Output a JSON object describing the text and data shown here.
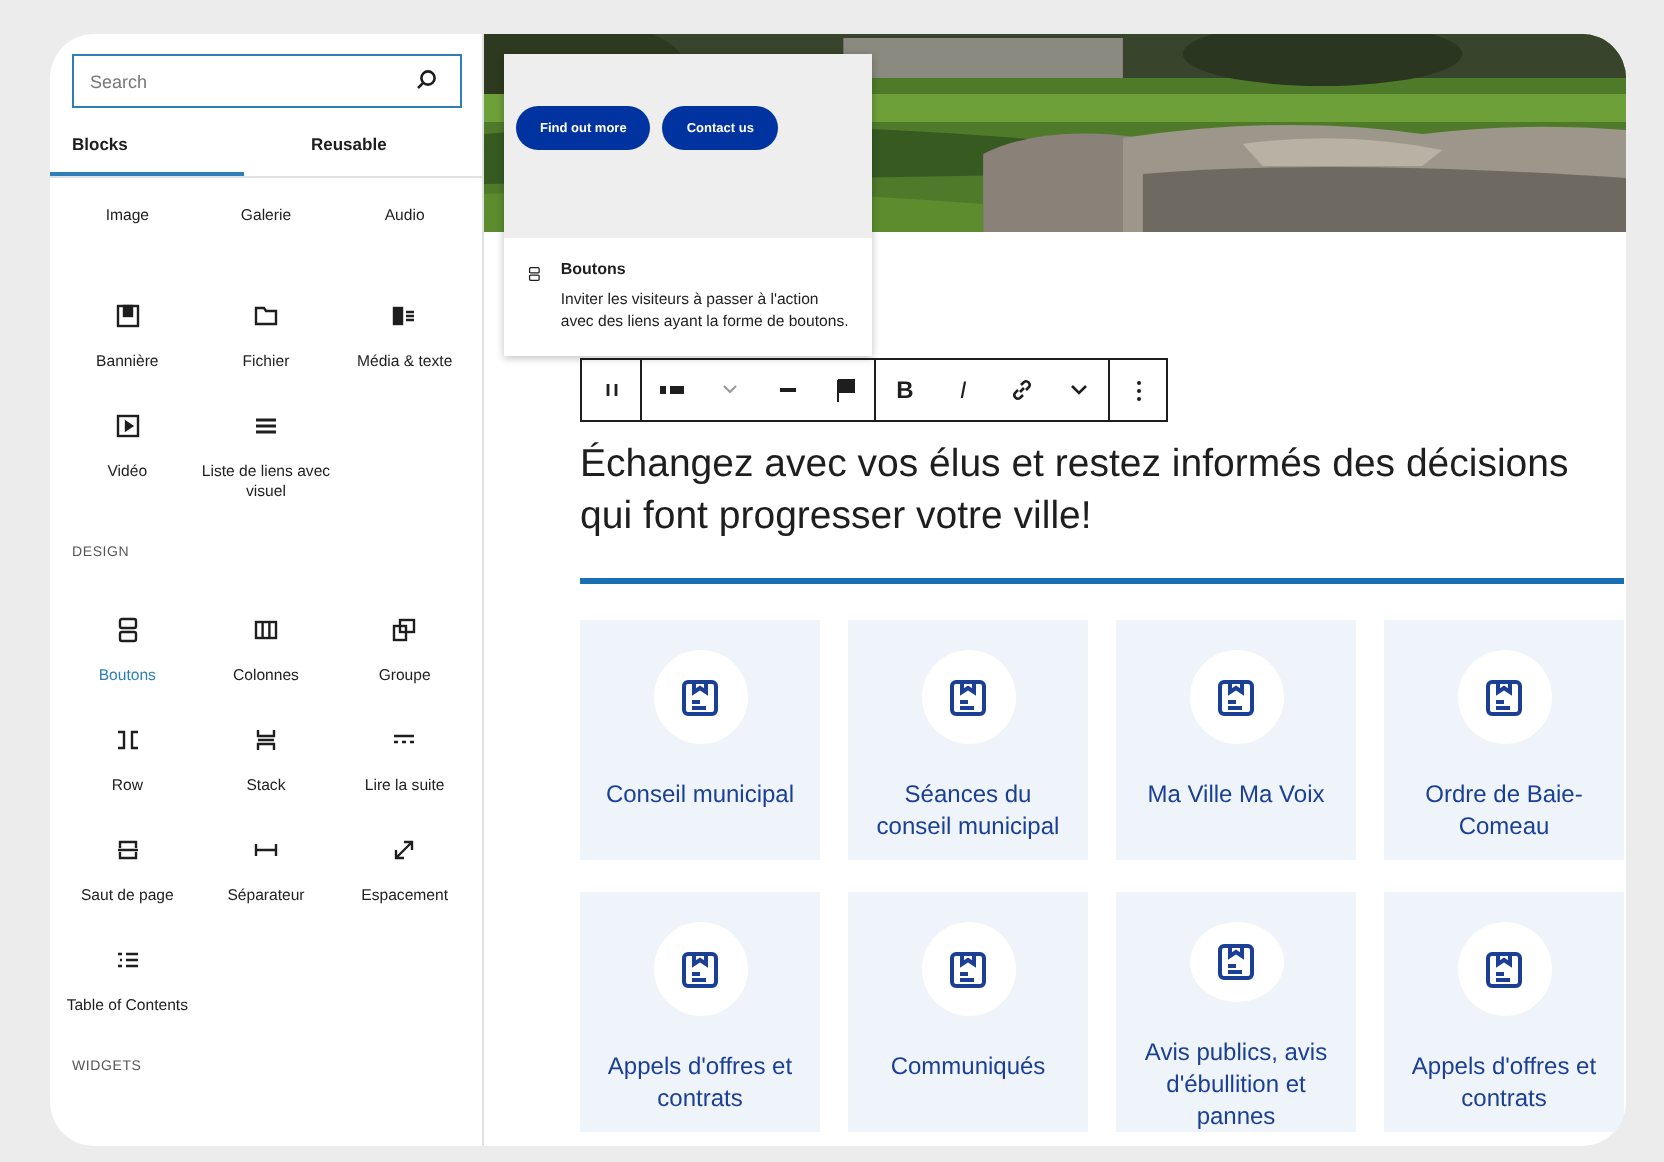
{
  "sidebar": {
    "search": {
      "placeholder": "Search"
    },
    "tabs": [
      {
        "label": "Blocks",
        "selected": true
      },
      {
        "label": "Reusable",
        "selected": false
      }
    ],
    "sections": [
      {
        "items": [
          {
            "label": "Image",
            "selected": false
          },
          {
            "label": "Galerie",
            "selected": false
          },
          {
            "label": "Audio",
            "selected": false
          },
          {
            "label": "Bannière",
            "selected": false
          },
          {
            "label": "Fichier",
            "selected": false
          },
          {
            "label": "Média & texte",
            "selected": false
          },
          {
            "label": "Vidéo",
            "selected": false
          },
          {
            "label": "Liste de liens avec visuel",
            "selected": false
          }
        ]
      },
      {
        "heading": "DESIGN",
        "items": [
          {
            "label": "Boutons",
            "selected": true
          },
          {
            "label": "Colonnes",
            "selected": false
          },
          {
            "label": "Groupe",
            "selected": false
          },
          {
            "label": "Row",
            "selected": false
          },
          {
            "label": "Stack",
            "selected": false
          },
          {
            "label": "Lire la suite",
            "selected": false
          },
          {
            "label": "Saut de page",
            "selected": false
          },
          {
            "label": "Séparateur",
            "selected": false
          },
          {
            "label": "Espacement",
            "selected": false
          },
          {
            "label": "Table of Contents",
            "selected": false
          }
        ]
      },
      {
        "heading": "WIDGETS"
      }
    ]
  },
  "preview": {
    "buttons": [
      "Find out more",
      "Contact us"
    ],
    "title": "Boutons",
    "description": "Inviter les visiteurs à passer à l'action avec des liens ayant la forme de boutons."
  },
  "toolbar": {
    "bold": "B",
    "italic": "I"
  },
  "heading": "Échangez avec vos élus et restez informés des décisions qui font progresser votre ville!",
  "cards": [
    {
      "label": "Conseil municipal"
    },
    {
      "label": "Séances du conseil municipal"
    },
    {
      "label": "Ma Ville Ma Voix"
    },
    {
      "label": "Ordre de Baie-Comeau"
    },
    {
      "label": "Appels d'offres et contrats"
    },
    {
      "label": "Communiqués"
    },
    {
      "label": "Avis publics, avis d'ébullition et pannes"
    },
    {
      "label": "Appels d'offres et contrats"
    }
  ]
}
